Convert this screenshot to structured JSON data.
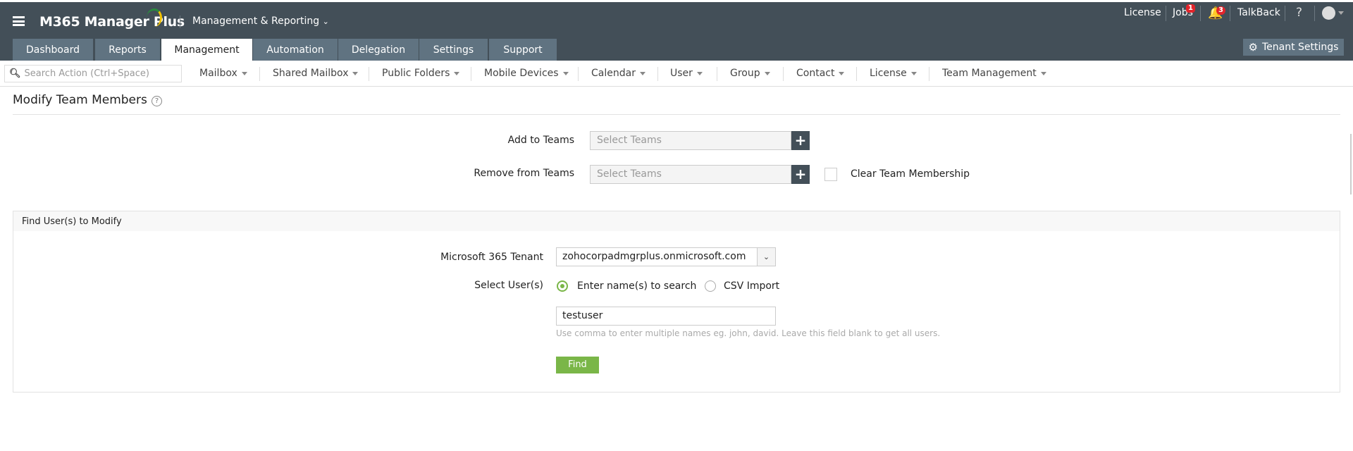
{
  "header": {
    "app_name": "M365 Manager Plus",
    "product_switch": "Management & Reporting",
    "top_links": {
      "license": "License",
      "jobs": "Jobs",
      "jobs_badge": "1",
      "alerts_badge": "3",
      "talkback": "TalkBack",
      "help": "?"
    },
    "tabs": [
      "Dashboard",
      "Reports",
      "Management",
      "Automation",
      "Delegation",
      "Settings",
      "Support"
    ],
    "active_tab": "Management",
    "tenant_settings": "Tenant Settings"
  },
  "subnav": {
    "search_placeholder": "Search Action (Ctrl+Space)",
    "menus": [
      "Mailbox",
      "Shared Mailbox",
      "Public Folders",
      "Mobile Devices",
      "Calendar",
      "User",
      "Group",
      "Contact",
      "License",
      "Team Management"
    ]
  },
  "page": {
    "title": "Modify Team Members",
    "help": "?"
  },
  "teams": {
    "add_label": "Add to Teams",
    "remove_label": "Remove from Teams",
    "placeholder": "Select Teams",
    "clear_label": "Clear Team Membership",
    "clear_checked": false
  },
  "find": {
    "section_title": "Find User(s) to Modify",
    "tenant_label": "Microsoft 365 Tenant",
    "tenant_value": "zohocorpadmgrplus.onmicrosoft.com",
    "select_label": "Select User(s)",
    "option_search": "Enter name(s) to search",
    "option_csv": "CSV Import",
    "selected_option": "search",
    "names_value": "testuser",
    "hint": "Use comma to enter multiple names eg. john, david. Leave this field blank to get all users.",
    "find_button": "Find"
  },
  "colors": {
    "header": "#434f58",
    "tab": "#607381",
    "accent": "#7ab648",
    "badge": "#e3242b"
  }
}
